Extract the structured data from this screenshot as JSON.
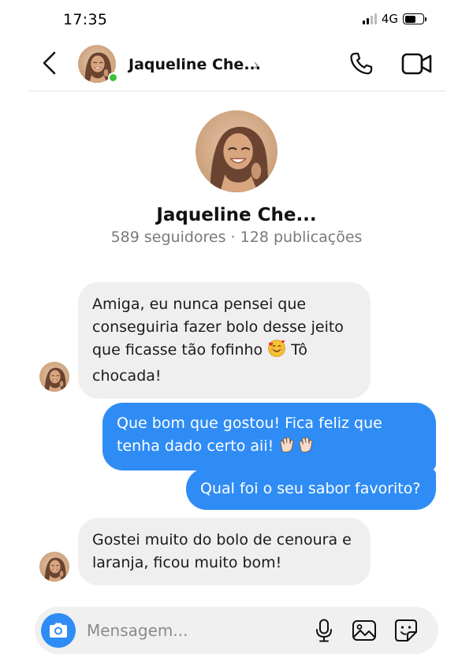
{
  "status_bar": {
    "time": "17:35",
    "network": "4G"
  },
  "header": {
    "contact_name": "Jaqueline Che...",
    "chevron": "›"
  },
  "profile": {
    "name": "Jaqueline Che...",
    "stats": "589 seguidores · 128 publicações"
  },
  "messages": [
    {
      "direction": "incoming",
      "text_before_emoji": "Amiga, eu nunca pensei que conseguiria fazer bolo desse jeito que ficasse tão fofinho ",
      "emoji": "smiling-face-with-hearts",
      "text_after_emoji": " Tô chocada!"
    },
    {
      "direction": "outgoing",
      "text": "Que bom que gostou! Fica feliz que tenha dado certo aii! ",
      "emoji": "clapping-hands"
    },
    {
      "direction": "outgoing",
      "text": "Qual foi o seu sabor favorito?"
    },
    {
      "direction": "incoming",
      "text": "Gostei muito do bolo de cenoura e laranja, ficou muito bom!"
    }
  ],
  "composer": {
    "placeholder": "Mensagem..."
  },
  "colors": {
    "accent": "#2f8cf5",
    "incoming_bubble": "#efefef",
    "online": "#3bc13b",
    "stats_text": "#7a7a7a"
  },
  "icons": [
    "back-icon",
    "chevron-right-icon",
    "phone-icon",
    "video-camera-icon",
    "camera-icon",
    "microphone-icon",
    "image-icon",
    "sticker-icon"
  ]
}
